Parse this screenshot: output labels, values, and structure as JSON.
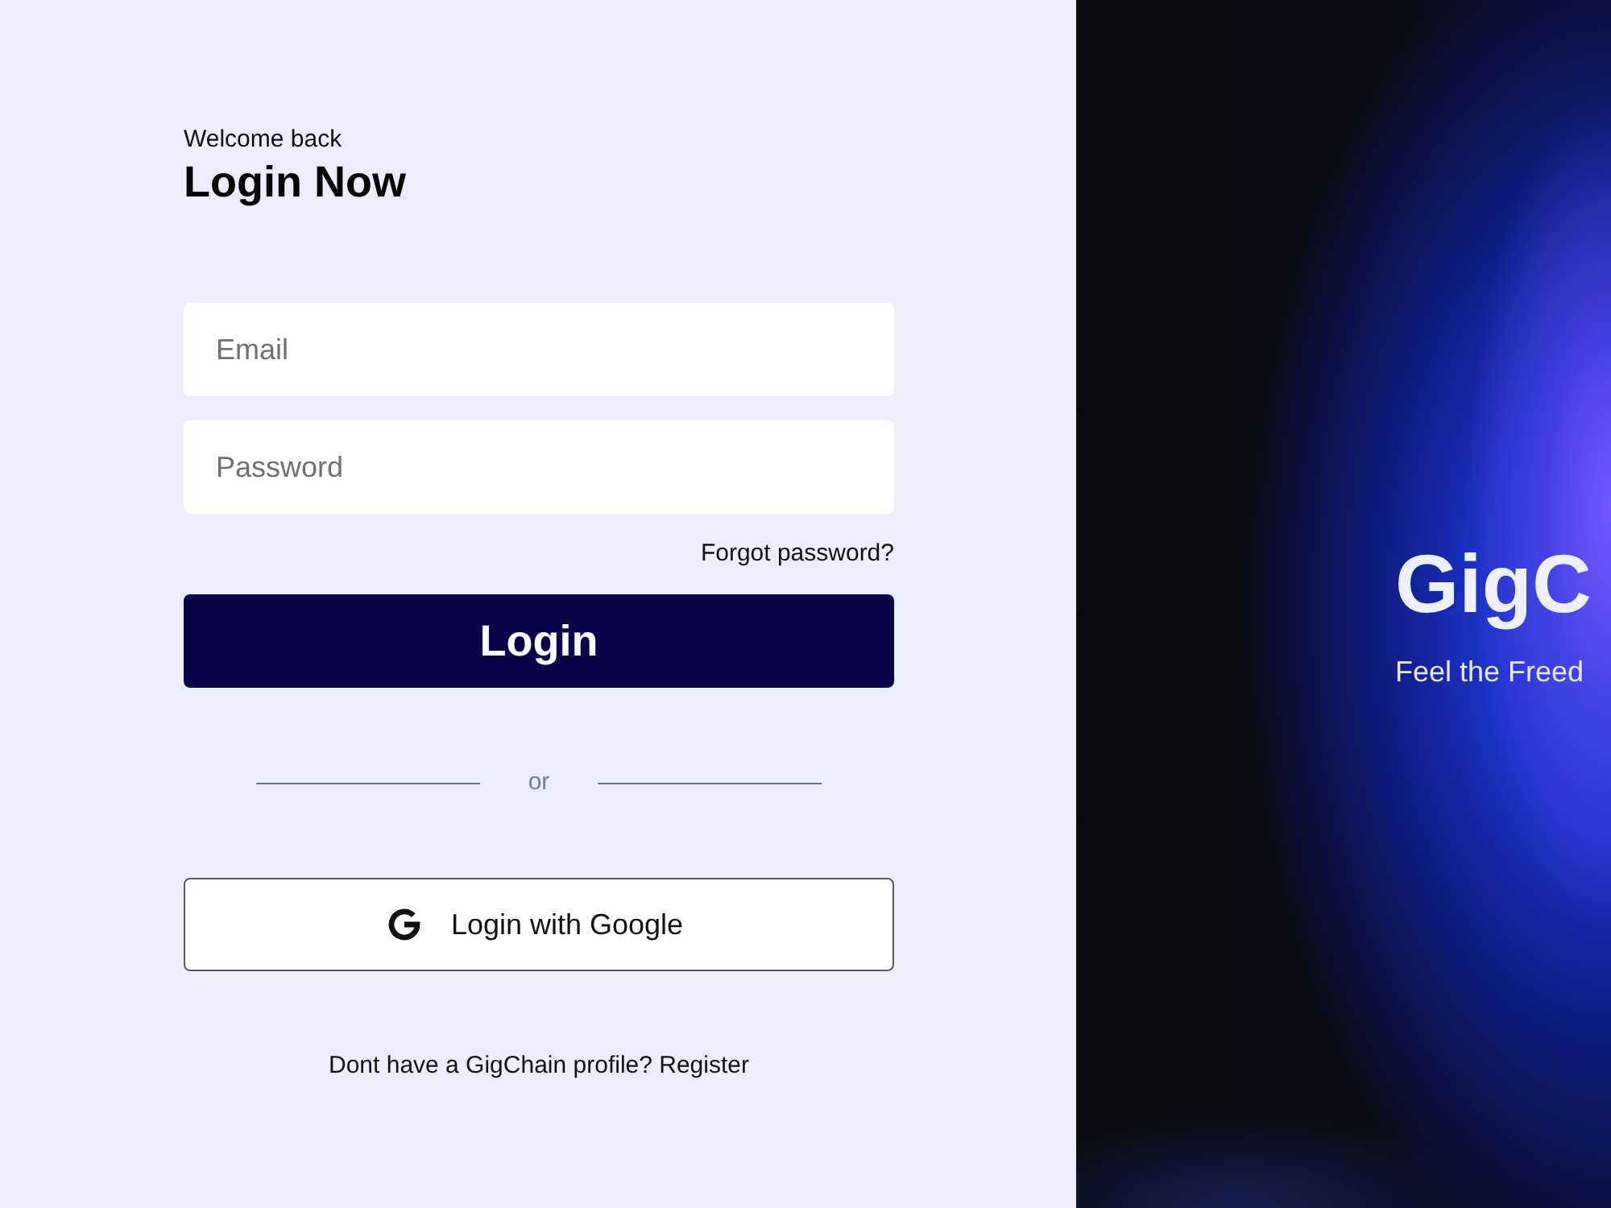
{
  "login_panel": {
    "greeting": "Welcome back",
    "title": "Login Now",
    "fields": [
      {
        "placeholder": "Email"
      },
      {
        "placeholder": "Password"
      }
    ],
    "forgot_link": "Forgot password?",
    "login_button": "Login",
    "divider_text": "or",
    "google_button": "Login with Google",
    "register_prompt": "Dont have a GigChain profile?",
    "register_link": "Register"
  },
  "hero_panel": {
    "brand": "GigC",
    "tagline": "Feel the Freed"
  }
}
